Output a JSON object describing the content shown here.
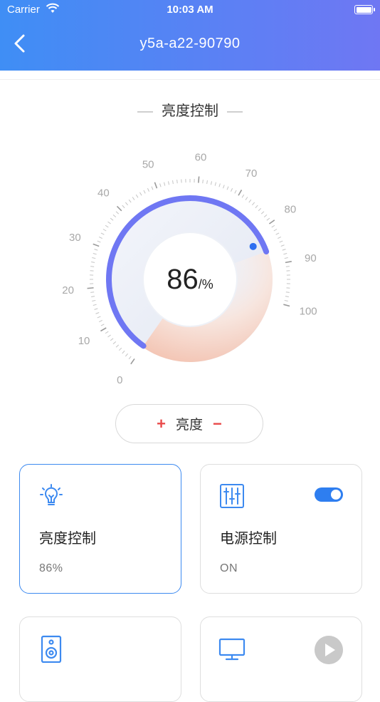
{
  "status_bar": {
    "carrier": "Carrier",
    "time": "10:03 AM"
  },
  "nav": {
    "title": "y5a-a22-90790",
    "back_icon": "chevron-left-icon"
  },
  "section": {
    "title": "亮度控制"
  },
  "gauge": {
    "value": "86",
    "unit": "/%",
    "level_percent": 86,
    "ticks": [
      "0",
      "10",
      "20",
      "30",
      "40",
      "50",
      "60",
      "70",
      "80",
      "90",
      "100"
    ],
    "colors": {
      "arc": "#6f77f3",
      "dot": "#2e6ff0",
      "warm": "#f4a78a",
      "cool": "#e6eaf5"
    }
  },
  "stepper": {
    "plus": "+",
    "label": "亮度",
    "minus": "−"
  },
  "cards": [
    {
      "name": "亮度控制",
      "value": "86%",
      "icon": "bulb-icon",
      "active": true
    },
    {
      "name": "电源控制",
      "value": "ON",
      "icon": "equalizer-icon",
      "toggle_on": true
    },
    {
      "icon": "speaker-icon"
    },
    {
      "icon": "monitor-icon",
      "extra_icon": "play-icon"
    }
  ],
  "colors": {
    "header_start": "#3f8ef5",
    "header_end": "#6f77f3",
    "accent": "#2e7ef0",
    "minus_plus": "#e94a4a"
  }
}
